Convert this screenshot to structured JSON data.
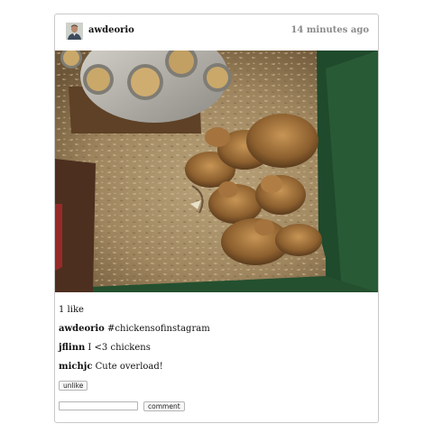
{
  "post": {
    "owner": "awdeorio",
    "timestamp": "14 minutes ago",
    "photo_description_icon": "photo-of-chicks-in-brooder",
    "likes_text": "1 like",
    "caption": {
      "user": "awdeorio",
      "text": "#chickensofinstagram"
    },
    "comments": [
      {
        "user": "jflinn",
        "text": "I <3 chickens"
      },
      {
        "user": "michjc",
        "text": "Cute overload!"
      }
    ]
  },
  "actions": {
    "unlike_label": "unlike",
    "comment_label": "comment",
    "comment_input_value": "",
    "comment_input_placeholder": ""
  },
  "colors": {
    "border": "#c8c8c8",
    "timestamp": "#8a8a8a",
    "username": "#111111"
  }
}
